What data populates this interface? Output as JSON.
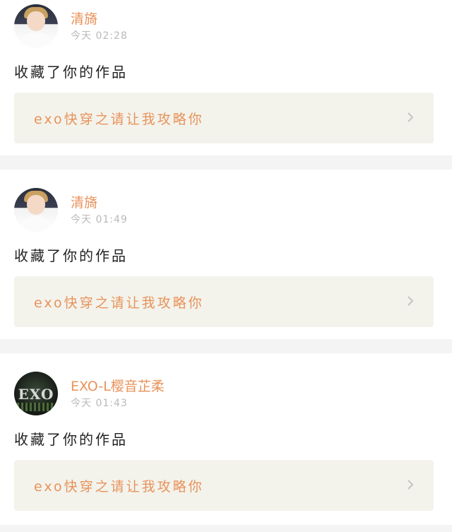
{
  "feed": {
    "items": [
      {
        "user": {
          "name": "清旖",
          "avatar": "person-avatar"
        },
        "time": "今天  02:28",
        "action": "收藏了你的作品",
        "work": {
          "title": "exo快穿之请让我攻略你"
        }
      },
      {
        "user": {
          "name": "清旖",
          "avatar": "person-avatar"
        },
        "time": "今天  01:49",
        "action": "收藏了你的作品",
        "work": {
          "title": "exo快穿之请让我攻略你"
        }
      },
      {
        "user": {
          "name": "EXO-L樱音芷柔",
          "avatar": "exo-logo-avatar"
        },
        "time": "今天  01:43",
        "action": "收藏了你的作品",
        "work": {
          "title": "exo快穿之请让我攻略你"
        }
      }
    ]
  },
  "colors": {
    "username": "#e8925a",
    "timestamp": "#b9b9b9",
    "card_link_bg": "#f3f3ec",
    "page_bg": "#f4f4f4"
  },
  "icons": {
    "chevron": "chevron-right-icon"
  }
}
